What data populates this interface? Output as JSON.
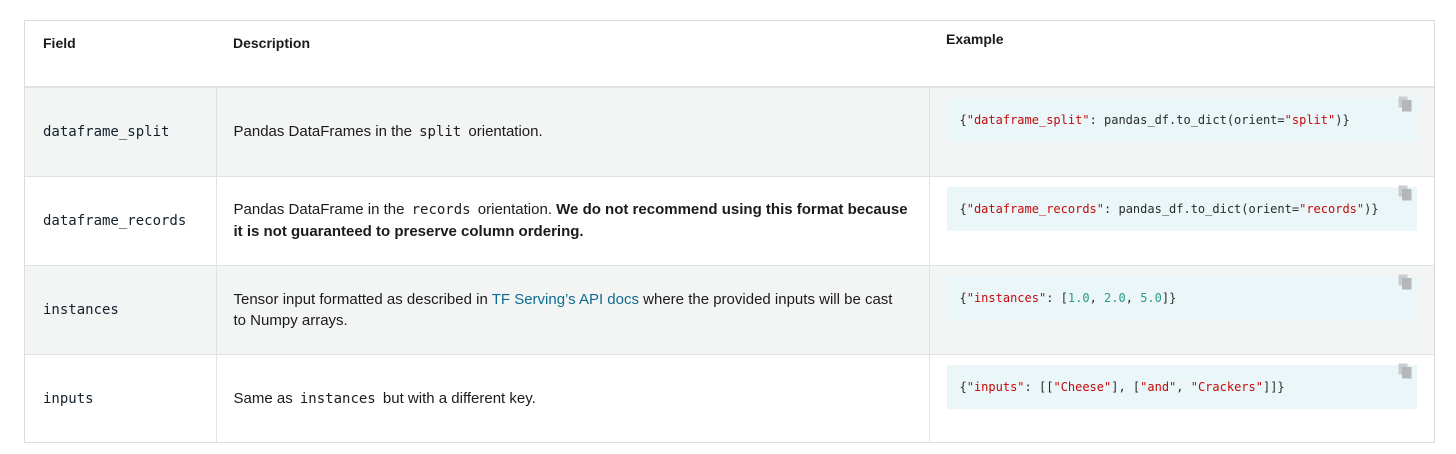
{
  "headers": {
    "field": "Field",
    "description": "Description",
    "example": "Example"
  },
  "rows": [
    {
      "field": "dataframe_split",
      "desc_pre": "Pandas DataFrames in the ",
      "desc_code": "split",
      "desc_post": " orientation.",
      "code": {
        "key": "\"dataframe_split\"",
        "mid": ": pandas_df.to_dict(orient=",
        "val": "\"split\"",
        "end": ")}"
      }
    },
    {
      "field": "dataframe_records",
      "desc_pre": "Pandas DataFrame in the ",
      "desc_code": "records",
      "desc_post": " orientation. ",
      "desc_bold": "We do not recommend using this format because it is not guaranteed to preserve column ordering.",
      "code": {
        "key": "\"dataframe_records\"",
        "mid": ": pandas_df.to_dict(orient=",
        "val": "\"records\"",
        "end": ")}"
      }
    },
    {
      "field": "instances",
      "desc_pre": "Tensor input formatted as described in ",
      "desc_link": "TF Serving’s API docs",
      "desc_post": " where the provided inputs will be cast to Numpy arrays.",
      "code": {
        "key": "\"instances\"",
        "mid": ": [",
        "n1": "1.0",
        "n2": "2.0",
        "n3": "5.0",
        "end": "]}"
      }
    },
    {
      "field": "inputs",
      "desc_pre": "Same as ",
      "desc_code": "instances",
      "desc_post": " but with a different key.",
      "code": {
        "key": "\"inputs\"",
        "mid": ": [[",
        "s1": "\"Cheese\"",
        "mid2": "], [",
        "s2": "\"and\"",
        "s3": "\"Crackers\"",
        "end": "]]}"
      }
    }
  ],
  "colors": {
    "string": "#c20a0a",
    "number": "#2a9a8a",
    "link": "#0f6b8e",
    "code_bg": "#eaf6f8",
    "row_alt": "#f3f5f5"
  },
  "icons": {
    "copy": "copy-icon"
  }
}
